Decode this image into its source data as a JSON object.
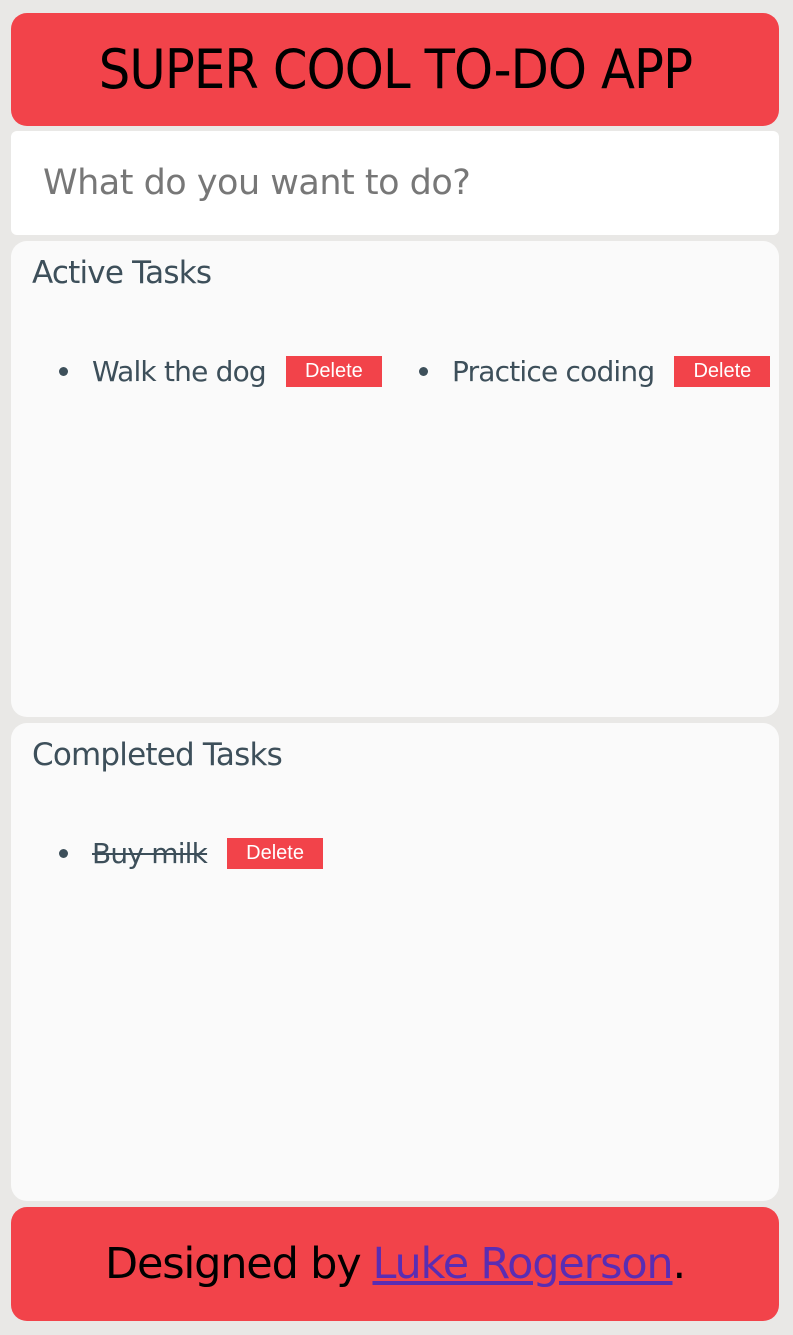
{
  "header": {
    "title": "SUPER COOL TO-DO APP"
  },
  "new_task": {
    "placeholder": "What do you want to do?",
    "value": ""
  },
  "active_panel": {
    "title": "Active Tasks",
    "tasks": [
      {
        "text": "Walk the dog",
        "delete_label": "Delete"
      },
      {
        "text": "Practice coding",
        "delete_label": "Delete"
      }
    ]
  },
  "completed_panel": {
    "title": "Completed Tasks",
    "tasks": [
      {
        "text": "Buy milk",
        "delete_label": "Delete"
      }
    ]
  },
  "footer": {
    "prefix": "Designed by",
    "author_link": "Luke Rogerson",
    "suffix": "."
  },
  "colors": {
    "accent": "#f2434a",
    "panel_bg": "#fafafa",
    "page_bg": "#e9e8e6",
    "text": "#3d4f5a",
    "link": "#5a2db3"
  }
}
